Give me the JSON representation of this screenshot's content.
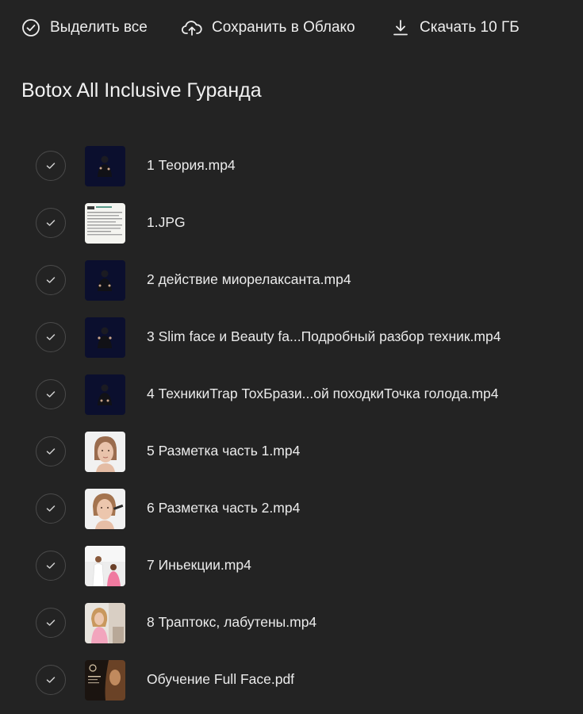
{
  "toolbar": {
    "select_all_label": "Выделить все",
    "select_all_icon": "check-circle-icon",
    "save_cloud_label": "Сохранить в Облако",
    "save_cloud_icon": "cloud-upload-icon",
    "download_label": "Скачать 10 ГБ",
    "download_icon": "download-icon"
  },
  "folder": {
    "title": "Botox All Inclusive Гуранда"
  },
  "files": [
    {
      "name": "1 Теория.mp4",
      "thumb": "video-lecture-thumbnail"
    },
    {
      "name": "1.JPG",
      "thumb": "document-image-thumbnail"
    },
    {
      "name": "2 действие миорелаксанта.mp4",
      "thumb": "video-lecture-thumbnail"
    },
    {
      "name": "3 Slim face и Beauty fa...Подробный разбор техник.mp4",
      "thumb": "video-lecture-thumbnail"
    },
    {
      "name": "4 ТехникиTrap ТохБрази...ой походкиТочка голода.mp4",
      "thumb": "video-lecture-thumbnail"
    },
    {
      "name": "5 Разметка часть 1.mp4",
      "thumb": "face-video-thumbnail"
    },
    {
      "name": "6 Разметка часть 2.mp4",
      "thumb": "face-video-thumbnail"
    },
    {
      "name": "7 Иньекции.mp4",
      "thumb": "clinic-video-thumbnail"
    },
    {
      "name": "8 Траптокс, лабутены.mp4",
      "thumb": "clinic-video-thumbnail"
    },
    {
      "name": "Обучение Full Face.pdf",
      "thumb": "pdf-cover-thumbnail"
    }
  ],
  "colors": {
    "background": "#232323",
    "text": "#ececec",
    "check_border": "#4a4a4a",
    "lecture_thumb_bg": "#0b0f2e"
  }
}
